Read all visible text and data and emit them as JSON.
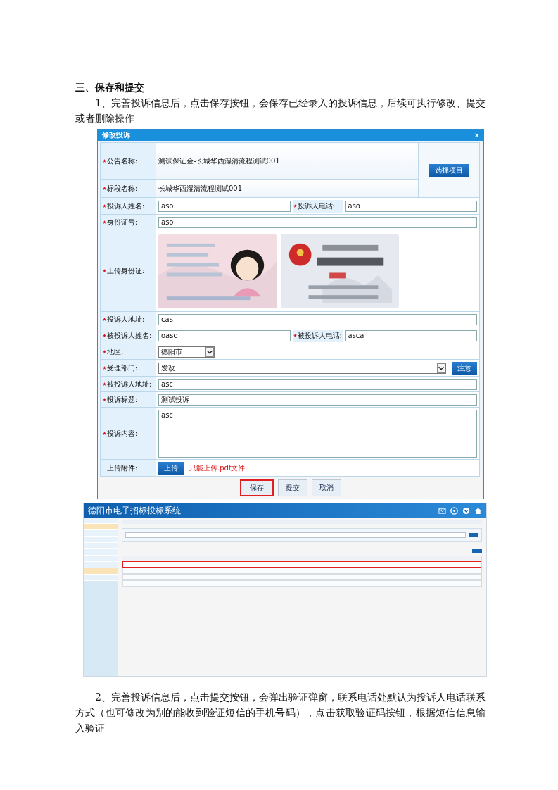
{
  "heading": "三、保存和提交",
  "paragraph_1": "1、完善投诉信息后，点击保存按钮，会保存已经录入的投诉信息，后续可执行修改、提交或者删除操作",
  "dialog": {
    "title": "修改投诉",
    "close": "×",
    "side_button": "选择项目",
    "rows": [
      {
        "kind": "static",
        "required": true,
        "label": "公告名称:",
        "value": "测试保证金-长城华西湿清流程测试001"
      },
      {
        "kind": "static",
        "required": true,
        "label": "标段名称:",
        "value": "长城华西湿清流程测试001"
      },
      {
        "kind": "pair",
        "required": true,
        "label": "投诉人姓名:",
        "value": "aso",
        "label_2": "投诉人电话:",
        "value_2": "aso"
      },
      {
        "kind": "input",
        "required": true,
        "label": "身份证号:",
        "value": "aso"
      },
      {
        "kind": "id-upload",
        "required": true,
        "label": "上传身份证:"
      },
      {
        "kind": "input",
        "required": true,
        "label": "投诉人地址:",
        "value": "cas"
      },
      {
        "kind": "pair",
        "required": true,
        "label": "被投诉人姓名:",
        "value": "oaso",
        "label_2": "被投诉人电话:",
        "value_2": "asca"
      },
      {
        "kind": "select-short",
        "required": true,
        "label": "地区:",
        "value": "德阳市"
      },
      {
        "kind": "select-wide",
        "required": true,
        "label": "受理部门:",
        "value": "发改",
        "button": "注意"
      },
      {
        "kind": "input",
        "required": true,
        "label": "被投诉人地址:",
        "value": "asc"
      },
      {
        "kind": "input",
        "required": true,
        "label": "投诉标题:",
        "value": "测试投诉"
      },
      {
        "kind": "textarea",
        "required": true,
        "label": "投诉内容:",
        "value": "asc"
      },
      {
        "kind": "upload",
        "required": false,
        "label": "上传附件:",
        "button": "上传",
        "note": "只能上传.pdf文件"
      }
    ],
    "buttons": [
      {
        "label": "保存",
        "highlighted": true
      },
      {
        "label": "提交",
        "highlighted": false
      },
      {
        "label": "取消",
        "highlighted": false
      }
    ]
  },
  "app": {
    "title": "德阳市电子招标投标系统",
    "sidebar_items": [
      {
        "selected": false
      },
      {
        "selected": true
      },
      {
        "selected": false
      },
      {
        "selected": false
      },
      {
        "selected": false
      },
      {
        "selected": false
      },
      {
        "selected": false
      },
      {
        "selected": false
      },
      {
        "selected": true
      },
      {
        "selected": false
      }
    ],
    "table_rows": [
      {
        "highlighted": true
      },
      {
        "highlighted": false
      },
      {
        "highlighted": false
      },
      {
        "highlighted": false
      }
    ]
  },
  "paragraph_2": "2、完善投诉信息后，点击提交按钮，会弹出验证弹窗，联系电话处默认为投诉人电话联系方式（也可修改为别的能收到验证短信的手机号码），点击获取验证码按钮，根据短信信息输入验证"
}
